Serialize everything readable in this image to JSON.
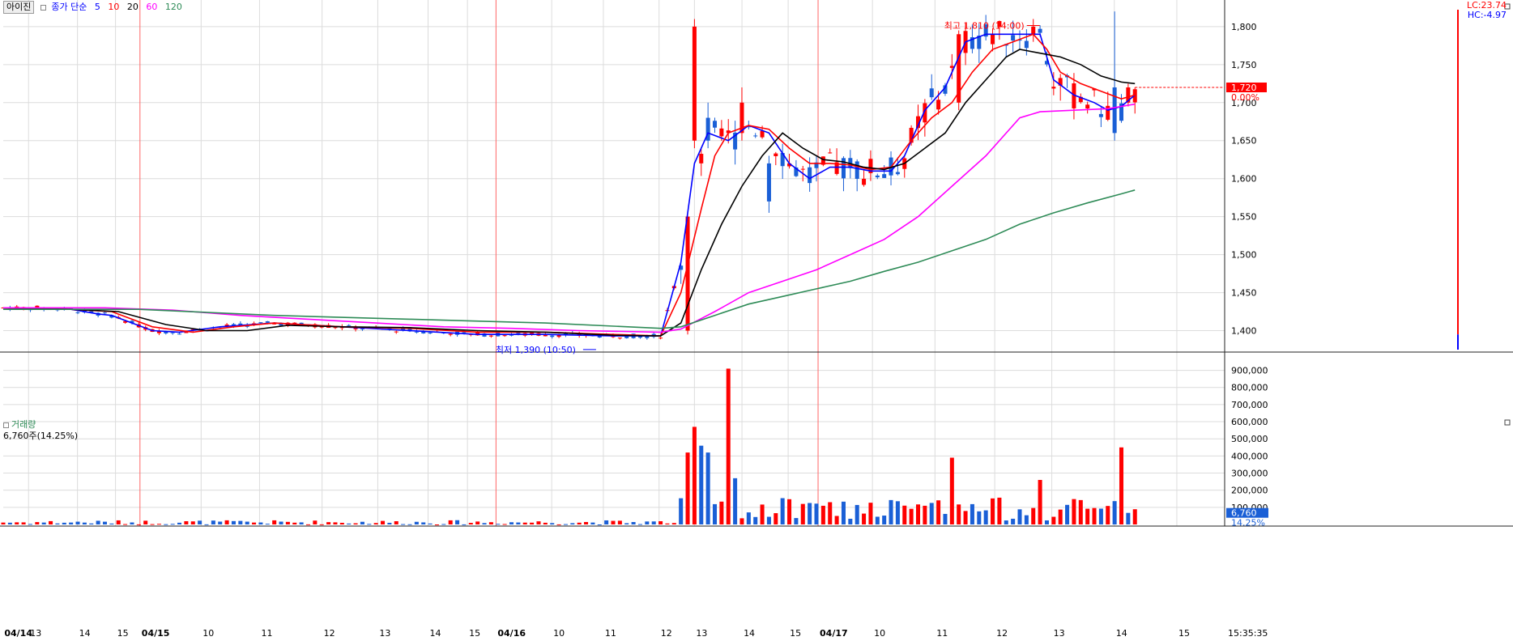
{
  "stock_name": "아이진",
  "legend": {
    "ma_prefix": "종가 단순",
    "ma5": "5",
    "ma10": "10",
    "ma20": "20",
    "ma60": "60",
    "ma120": "120",
    "colors": {
      "ma5": "#0000ff",
      "ma10": "#ff0000",
      "ma20": "#000000",
      "ma60": "#ff00ff",
      "ma120": "#2e8b57"
    }
  },
  "lc_text": "LC:23.74",
  "hc_text": "HC:-4.97",
  "current_price_label": "1,720",
  "change_label": "0.00%",
  "high_annotation": "최고 1,810 (14:00)",
  "low_annotation": "최저 1,390 (10:50)",
  "volume_panel": {
    "title": "거래량",
    "current": "6,760주(14.25%)",
    "current_box": "6,760",
    "current_pct": "14.25%"
  },
  "time_label": "15:35:35",
  "price_axis": {
    "ticks": [
      "1,800",
      "1,750",
      "1,700",
      "1,650",
      "1,600",
      "1,550",
      "1,500",
      "1,450",
      "1,400"
    ]
  },
  "volume_axis": {
    "ticks": [
      "900,000",
      "800,000",
      "700,000",
      "600,000",
      "500,000",
      "400,000",
      "300,000",
      "200,000",
      "100,000"
    ]
  },
  "x_axis": {
    "labels": [
      {
        "t": "04/14",
        "bold": true
      },
      {
        "t": "13"
      },
      {
        "t": "14"
      },
      {
        "t": "15"
      },
      {
        "t": "04/15",
        "bold": true
      },
      {
        "t": "10"
      },
      {
        "t": "11"
      },
      {
        "t": "12"
      },
      {
        "t": "13"
      },
      {
        "t": "14"
      },
      {
        "t": "15"
      },
      {
        "t": "04/16",
        "bold": true
      },
      {
        "t": "10"
      },
      {
        "t": "11"
      },
      {
        "t": "12"
      },
      {
        "t": "13"
      },
      {
        "t": "14"
      },
      {
        "t": "15"
      },
      {
        "t": "04/17",
        "bold": true
      },
      {
        "t": "10"
      },
      {
        "t": "11"
      },
      {
        "t": "12"
      },
      {
        "t": "13"
      },
      {
        "t": "14"
      },
      {
        "t": "15"
      }
    ]
  },
  "chart_data": {
    "type": "candlestick",
    "title": "아이진",
    "ylim": [
      1375,
      1835
    ],
    "volume_ylim": [
      0,
      950000
    ],
    "series": [
      {
        "name": "MA5",
        "color": "#0000ff",
        "points": [
          [
            0,
            1430
          ],
          [
            5,
            1430
          ],
          [
            10,
            1428
          ],
          [
            14,
            1422
          ],
          [
            16,
            1420
          ],
          [
            22,
            1400
          ],
          [
            26,
            1398
          ],
          [
            32,
            1405
          ],
          [
            40,
            1410
          ],
          [
            50,
            1405
          ],
          [
            60,
            1400
          ],
          [
            70,
            1395
          ],
          [
            80,
            1395
          ],
          [
            90,
            1393
          ],
          [
            97,
            1393
          ],
          [
            100,
            1490
          ],
          [
            102,
            1620
          ],
          [
            104,
            1660
          ],
          [
            107,
            1650
          ],
          [
            110,
            1670
          ],
          [
            113,
            1660
          ],
          [
            116,
            1620
          ],
          [
            119,
            1600
          ],
          [
            122,
            1615
          ],
          [
            125,
            1615
          ],
          [
            128,
            1610
          ],
          [
            131,
            1610
          ],
          [
            133,
            1630
          ],
          [
            136,
            1690
          ],
          [
            139,
            1720
          ],
          [
            142,
            1780
          ],
          [
            145,
            1790
          ],
          [
            148,
            1790
          ],
          [
            151,
            1790
          ],
          [
            153,
            1790
          ],
          [
            155,
            1730
          ],
          [
            158,
            1710
          ],
          [
            161,
            1700
          ],
          [
            163,
            1690
          ],
          [
            165,
            1695
          ],
          [
            167,
            1710
          ]
        ]
      },
      {
        "name": "MA10",
        "color": "#ff0000",
        "points": [
          [
            0,
            1430
          ],
          [
            10,
            1428
          ],
          [
            16,
            1425
          ],
          [
            22,
            1405
          ],
          [
            28,
            1398
          ],
          [
            34,
            1405
          ],
          [
            40,
            1410
          ],
          [
            50,
            1405
          ],
          [
            60,
            1403
          ],
          [
            70,
            1398
          ],
          [
            80,
            1398
          ],
          [
            90,
            1395
          ],
          [
            97,
            1393
          ],
          [
            100,
            1450
          ],
          [
            103,
            1560
          ],
          [
            105,
            1630
          ],
          [
            107,
            1660
          ],
          [
            110,
            1670
          ],
          [
            113,
            1665
          ],
          [
            116,
            1640
          ],
          [
            119,
            1620
          ],
          [
            122,
            1620
          ],
          [
            125,
            1618
          ],
          [
            128,
            1612
          ],
          [
            131,
            1615
          ],
          [
            134,
            1650
          ],
          [
            137,
            1680
          ],
          [
            140,
            1700
          ],
          [
            143,
            1740
          ],
          [
            146,
            1770
          ],
          [
            149,
            1780
          ],
          [
            152,
            1790
          ],
          [
            154,
            1770
          ],
          [
            156,
            1740
          ],
          [
            159,
            1725
          ],
          [
            162,
            1715
          ],
          [
            165,
            1705
          ],
          [
            167,
            1710
          ]
        ]
      },
      {
        "name": "MA20",
        "color": "#000000",
        "points": [
          [
            0,
            1430
          ],
          [
            10,
            1428
          ],
          [
            17,
            1425
          ],
          [
            24,
            1408
          ],
          [
            30,
            1400
          ],
          [
            36,
            1400
          ],
          [
            42,
            1407
          ],
          [
            50,
            1405
          ],
          [
            60,
            1404
          ],
          [
            70,
            1400
          ],
          [
            80,
            1398
          ],
          [
            90,
            1394
          ],
          [
            97,
            1393
          ],
          [
            100,
            1410
          ],
          [
            103,
            1480
          ],
          [
            106,
            1540
          ],
          [
            109,
            1590
          ],
          [
            112,
            1630
          ],
          [
            115,
            1660
          ],
          [
            118,
            1640
          ],
          [
            121,
            1625
          ],
          [
            124,
            1622
          ],
          [
            127,
            1615
          ],
          [
            130,
            1612
          ],
          [
            133,
            1620
          ],
          [
            136,
            1640
          ],
          [
            139,
            1660
          ],
          [
            142,
            1700
          ],
          [
            145,
            1730
          ],
          [
            148,
            1760
          ],
          [
            150,
            1770
          ],
          [
            153,
            1765
          ],
          [
            156,
            1760
          ],
          [
            159,
            1750
          ],
          [
            162,
            1735
          ],
          [
            165,
            1727
          ],
          [
            167,
            1725
          ]
        ]
      },
      {
        "name": "MA60",
        "color": "#ff00ff",
        "points": [
          [
            0,
            1430
          ],
          [
            15,
            1430
          ],
          [
            25,
            1427
          ],
          [
            35,
            1420
          ],
          [
            45,
            1415
          ],
          [
            55,
            1410
          ],
          [
            65,
            1405
          ],
          [
            75,
            1403
          ],
          [
            85,
            1400
          ],
          [
            97,
            1398
          ],
          [
            100,
            1402
          ],
          [
            105,
            1425
          ],
          [
            110,
            1450
          ],
          [
            115,
            1465
          ],
          [
            120,
            1480
          ],
          [
            125,
            1500
          ],
          [
            130,
            1520
          ],
          [
            135,
            1550
          ],
          [
            140,
            1590
          ],
          [
            145,
            1630
          ],
          [
            150,
            1680
          ],
          [
            153,
            1688
          ],
          [
            158,
            1690
          ],
          [
            163,
            1692
          ],
          [
            167,
            1698
          ]
        ]
      },
      {
        "name": "MA120",
        "color": "#2e8b57",
        "points": [
          [
            0,
            1428
          ],
          [
            20,
            1428
          ],
          [
            40,
            1420
          ],
          [
            60,
            1415
          ],
          [
            80,
            1410
          ],
          [
            97,
            1403
          ],
          [
            100,
            1405
          ],
          [
            105,
            1420
          ],
          [
            110,
            1435
          ],
          [
            115,
            1445
          ],
          [
            120,
            1455
          ],
          [
            125,
            1465
          ],
          [
            130,
            1478
          ],
          [
            135,
            1490
          ],
          [
            140,
            1505
          ],
          [
            145,
            1520
          ],
          [
            150,
            1540
          ],
          [
            155,
            1555
          ],
          [
            160,
            1568
          ],
          [
            165,
            1580
          ],
          [
            167,
            1585
          ]
        ]
      }
    ],
    "candles_sample": [
      {
        "x": 101,
        "open": 1400,
        "close": 1550,
        "high": 1555,
        "low": 1395,
        "dir": "up"
      },
      {
        "x": 102,
        "open": 1650,
        "close": 1800,
        "high": 1810,
        "low": 1640,
        "dir": "up"
      },
      {
        "x": 104,
        "open": 1680,
        "close": 1650,
        "high": 1700,
        "low": 1640,
        "dir": "down"
      },
      {
        "x": 109,
        "open": 1660,
        "close": 1700,
        "high": 1720,
        "low": 1650,
        "dir": "up"
      },
      {
        "x": 113,
        "open": 1620,
        "close": 1570,
        "high": 1630,
        "low": 1555,
        "dir": "down"
      },
      {
        "x": 141,
        "open": 1700,
        "close": 1790,
        "high": 1795,
        "low": 1690,
        "dir": "up"
      },
      {
        "x": 152,
        "open": 1790,
        "close": 1800,
        "high": 1810,
        "low": 1780,
        "dir": "up"
      },
      {
        "x": 164,
        "open": 1720,
        "close": 1660,
        "high": 1820,
        "low": 1650,
        "dir": "down"
      },
      {
        "x": 166,
        "open": 1700,
        "close": 1720,
        "high": 1725,
        "low": 1695,
        "dir": "up"
      }
    ],
    "volume_sample": [
      {
        "x": 101,
        "v": 420000,
        "dir": "up"
      },
      {
        "x": 102,
        "v": 570000,
        "dir": "up"
      },
      {
        "x": 103,
        "v": 460000,
        "dir": "down"
      },
      {
        "x": 104,
        "v": 420000,
        "dir": "down"
      },
      {
        "x": 107,
        "v": 910000,
        "dir": "up"
      },
      {
        "x": 108,
        "v": 270000,
        "dir": "down"
      },
      {
        "x": 140,
        "v": 390000,
        "dir": "up"
      },
      {
        "x": 153,
        "v": 260000,
        "dir": "up"
      },
      {
        "x": 165,
        "v": 450000,
        "dir": "up"
      },
      {
        "x": 166,
        "v": 67600,
        "dir": "down"
      }
    ]
  }
}
